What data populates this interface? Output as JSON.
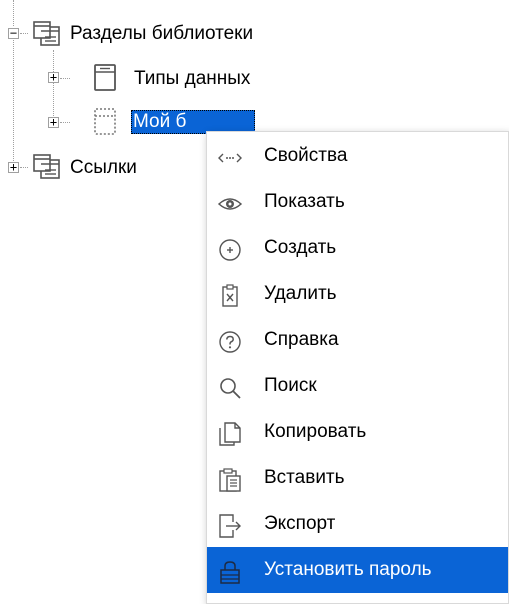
{
  "tree": {
    "items": [
      {
        "label": "Разделы библиотеки",
        "expander": "−",
        "icon": "folder-window-icon"
      },
      {
        "label": "Типы данных",
        "expander": "+",
        "icon": "book-icon"
      },
      {
        "label": "Мой б",
        "expander": "+",
        "icon": "book-dotted-icon",
        "selected": true
      },
      {
        "label": "Ссылки",
        "expander": "+",
        "icon": "folder-window-icon"
      }
    ]
  },
  "context_menu": {
    "items": [
      {
        "label": "Свойства",
        "icon": "properties-arrows-icon"
      },
      {
        "label": "Показать",
        "icon": "eye-icon"
      },
      {
        "label": "Создать",
        "icon": "plus-circle-icon"
      },
      {
        "label": "Удалить",
        "icon": "delete-clipboard-icon"
      },
      {
        "label": "Справка",
        "icon": "question-circle-icon"
      },
      {
        "label": "Поиск",
        "icon": "magnifier-icon"
      },
      {
        "label": "Копировать",
        "icon": "copy-icon"
      },
      {
        "label": "Вставить",
        "icon": "paste-icon"
      },
      {
        "label": "Экспорт",
        "icon": "export-icon"
      },
      {
        "label": "Установить пароль",
        "icon": "lock-icon",
        "highlighted": true
      }
    ]
  },
  "colors": {
    "selection": "#0a64d6",
    "icon_gray": "#555555"
  }
}
